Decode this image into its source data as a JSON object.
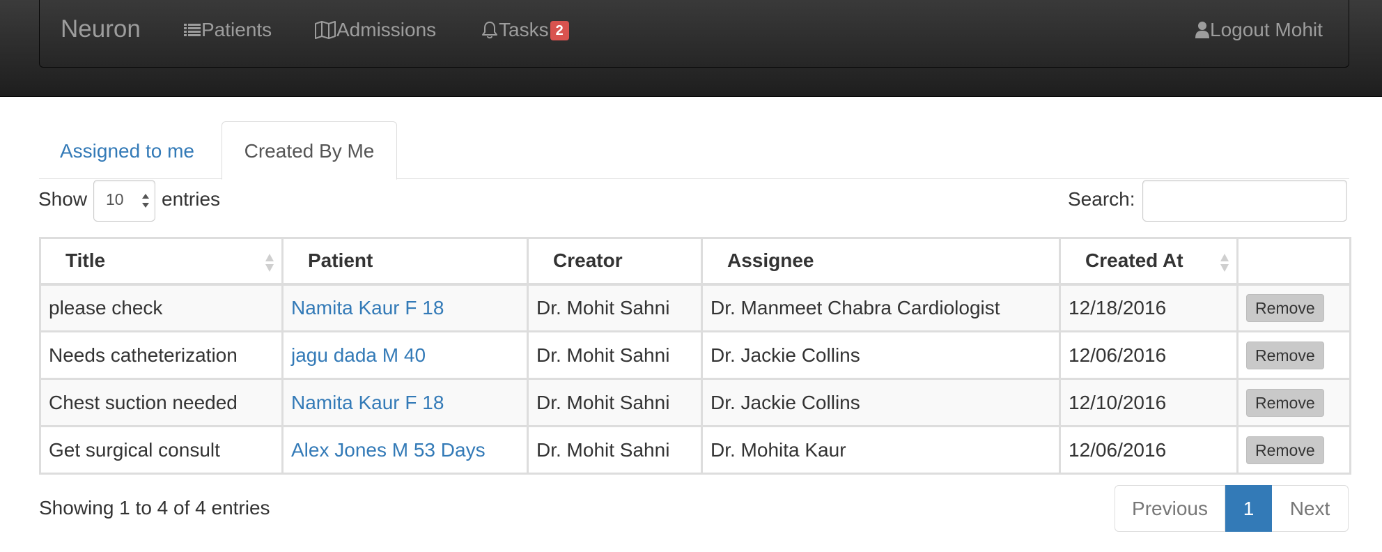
{
  "navbar": {
    "brand": "Neuron",
    "items": [
      {
        "label": "Patients",
        "icon": "list-icon"
      },
      {
        "label": "Admissions",
        "icon": "book-icon"
      },
      {
        "label": "Tasks",
        "icon": "bell-icon",
        "badge": "2"
      }
    ],
    "logout_label": "Logout Mohit",
    "logout_icon": "user-icon"
  },
  "tabs": [
    {
      "label": "Assigned to me",
      "active": false
    },
    {
      "label": "Created By Me",
      "active": true
    }
  ],
  "length_control": {
    "show_label": "Show",
    "value": "10",
    "entries_label": "entries"
  },
  "search": {
    "label": "Search:",
    "value": ""
  },
  "table": {
    "columns": [
      "Title",
      "Patient",
      "Creator",
      "Assignee",
      "Created At",
      ""
    ],
    "rows": [
      {
        "title": "please check",
        "patient": "Namita Kaur F 18",
        "creator": "Dr. Mohit Sahni",
        "assignee": "Dr. Manmeet Chabra Cardiologist",
        "created_at": "12/18/2016",
        "action": "Remove"
      },
      {
        "title": "Needs catheterization",
        "patient": "jagu dada M 40",
        "creator": "Dr. Mohit Sahni",
        "assignee": "Dr. Jackie Collins",
        "created_at": "12/06/2016",
        "action": "Remove"
      },
      {
        "title": "Chest suction needed",
        "patient": "Namita Kaur F 18",
        "creator": "Dr. Mohit Sahni",
        "assignee": "Dr. Jackie Collins",
        "created_at": "12/10/2016",
        "action": "Remove"
      },
      {
        "title": "Get surgical consult",
        "patient": "Alex Jones M 53 Days",
        "creator": "Dr. Mohit Sahni",
        "assignee": "Dr. Mohita Kaur",
        "created_at": "12/06/2016",
        "action": "Remove"
      }
    ]
  },
  "info_text": "Showing 1 to 4 of 4 entries",
  "pagination": {
    "previous": "Previous",
    "current": "1",
    "next": "Next"
  },
  "colors": {
    "navbar_bg": "#222222",
    "link": "#337ab7",
    "badge": "#d9534f",
    "active_page": "#337ab7"
  }
}
